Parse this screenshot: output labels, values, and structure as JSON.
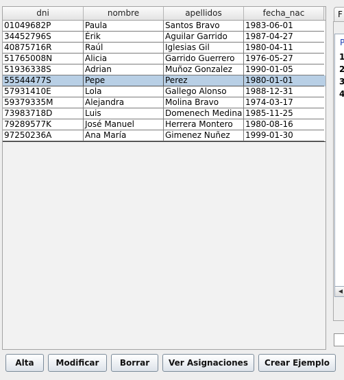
{
  "table": {
    "columns": [
      "dni",
      "nombre",
      "apellidos",
      "fecha_nac"
    ],
    "rows": [
      [
        "01049682P",
        "Paula",
        "Santos Bravo",
        "1983-06-01"
      ],
      [
        "34452796S",
        "Érik",
        "Aguilar Garrido",
        "1987-04-27"
      ],
      [
        "40875716R",
        "Raúl",
        "Iglesias Gil",
        "1980-04-11"
      ],
      [
        "51765008N",
        "Alicia",
        "Garrido Guerrero",
        "1976-05-27"
      ],
      [
        "51936338S",
        "Adrian",
        "Muñoz Gonzalez",
        "1990-01-05"
      ],
      [
        "55544477S",
        "Pepe",
        "Perez",
        "1980-01-01"
      ],
      [
        "57931410E",
        "Lola",
        "Gallego Alonso",
        "1988-12-31"
      ],
      [
        "59379335M",
        "Alejandra",
        "Molina Bravo",
        "1974-03-17"
      ],
      [
        "73983718D",
        "Luis",
        "Domenech Medina",
        "1985-11-25"
      ],
      [
        "79289577K",
        "José Manuel",
        "Herrera Montero",
        "1980-08-16"
      ],
      [
        "97250236A",
        "Ana María",
        "Gimenez Nuñez",
        "1999-01-30"
      ]
    ],
    "selected_row": 5
  },
  "right_panel": {
    "tab_label": "F",
    "title": "P",
    "numbers": [
      "1",
      "2",
      "3",
      "4"
    ]
  },
  "buttons": {
    "alta": "Alta",
    "modificar": "Modificar",
    "borrar": "Borrar",
    "ver_asignaciones": "Ver Asignaciones",
    "crear_ejemplo": "Crear Ejemplo"
  },
  "colors": {
    "selection": "#b8cfe5",
    "right_title": "#1f3fb3"
  }
}
